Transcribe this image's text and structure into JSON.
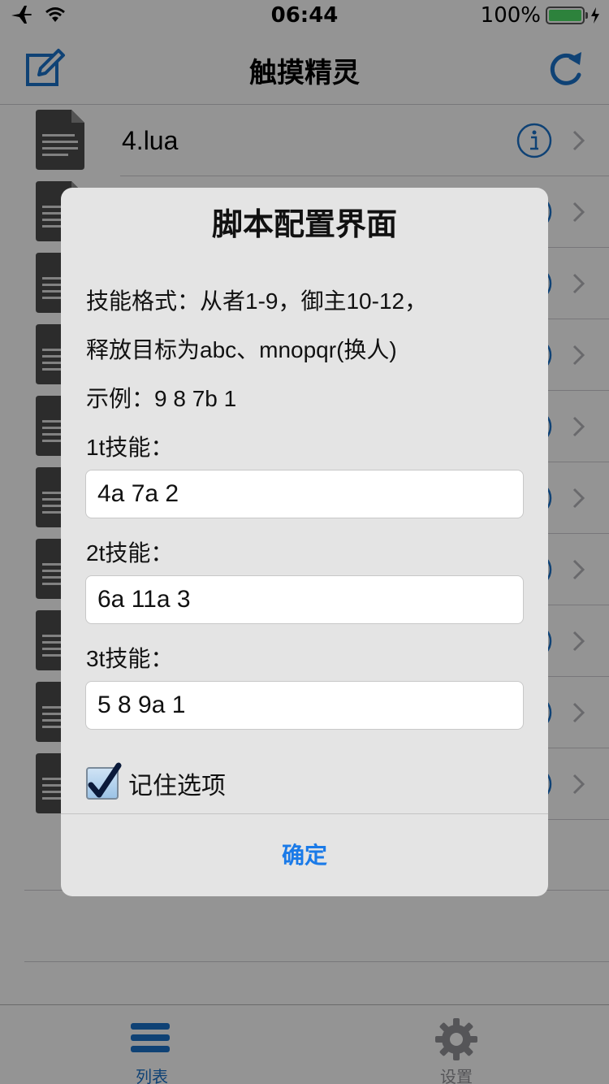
{
  "status_bar": {
    "time": "06:44",
    "battery_percent": "100%",
    "battery_level": 1.0
  },
  "nav": {
    "title": "触摸精灵",
    "left_icon": "compose-icon",
    "right_icon": "refresh-icon"
  },
  "list": {
    "items": [
      {
        "name": "4.lua"
      },
      {
        "name": ""
      },
      {
        "name": ""
      },
      {
        "name": ""
      },
      {
        "name": ""
      },
      {
        "name": ""
      },
      {
        "name": ""
      },
      {
        "name": ""
      },
      {
        "name": ""
      },
      {
        "name": ""
      }
    ]
  },
  "dialog": {
    "title": "脚本配置界面",
    "line1": "技能格式：从者1-9，御主10-12，",
    "line2": "释放目标为abc、mnopqr(换人)",
    "line3": "示例：9 8 7b 1",
    "field1_label": "1t技能：",
    "field1_value": "4a 7a 2",
    "field2_label": "2t技能：",
    "field2_value": "6a 11a 3",
    "field3_label": "3t技能：",
    "field3_value": "5 8 9a 1",
    "remember_label": "记住选项",
    "remember_checked": true,
    "confirm_label": "确定"
  },
  "tab_bar": {
    "tabs": [
      {
        "label": "列表",
        "icon": "list-icon",
        "active": true
      },
      {
        "label": "设置",
        "icon": "gear-icon",
        "active": false
      }
    ]
  },
  "colors": {
    "accent": "#1a6fc4",
    "link": "#1a7ae8",
    "battery": "#4cd964"
  }
}
